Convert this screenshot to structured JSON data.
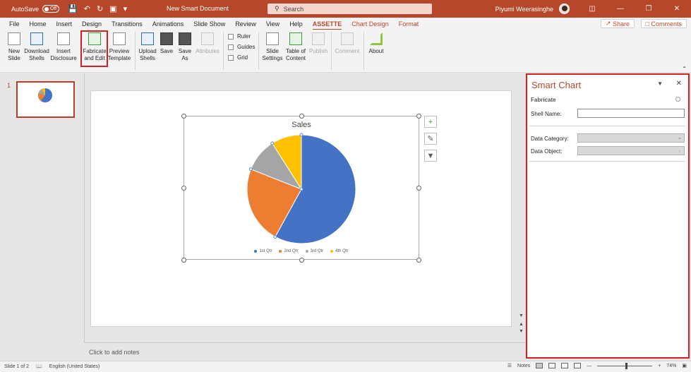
{
  "titlebar": {
    "autosave_label": "AutoSave",
    "autosave_state": "Off",
    "doc_title": "New Smart Document",
    "search_placeholder": "Search",
    "user_name": "Piyumi Weerasinghe",
    "accent_color": "#b7472a"
  },
  "menu": {
    "tabs": [
      "File",
      "Home",
      "Insert",
      "Design",
      "Transitions",
      "Animations",
      "Slide Show",
      "Review",
      "View",
      "Help",
      "ASSETTE",
      "Chart Design",
      "Format"
    ],
    "active_tab": "ASSETTE",
    "share_label": "Share",
    "comments_label": "Comments"
  },
  "ribbon": {
    "new_slide": "New Slide",
    "download_shells": "Download Shells",
    "insert_disclosure": "Insert Disclosure",
    "fabricate_edit": "Fabricate and Edit",
    "preview_template": "Preview Template",
    "upload_shells": "Upload Shells",
    "save": "Save",
    "save_as": "Save As",
    "attributes": "Attributes",
    "ruler": "Ruler",
    "guides": "Guides",
    "grid": "Grid",
    "slide_settings": "Slide Settings",
    "table_of_content": "Table of Content",
    "publish": "Publish",
    "comment": "Comment",
    "about": "About"
  },
  "thumbnails": {
    "slide_number": "1"
  },
  "chart_data": {
    "type": "pie",
    "title": "Sales",
    "categories": [
      "1st Qtr",
      "2nd Qtr",
      "3rd Qtr",
      "4th Qtr"
    ],
    "values": [
      58,
      23,
      10,
      9
    ],
    "colors": [
      "#4472c4",
      "#ed7d31",
      "#a5a5a5",
      "#ffc000"
    ],
    "legend_position": "bottom"
  },
  "notes": {
    "placeholder": "Click to add notes"
  },
  "taskpane": {
    "title": "Smart Chart",
    "section": "Fabricate",
    "shell_name_label": "Shell Name:",
    "shell_name_value": "",
    "data_category_label": "Data Category:",
    "data_object_label": "Data Object:"
  },
  "statusbar": {
    "slide_info": "Slide 1 of 2",
    "language": "English (United States)",
    "notes_label": "Notes",
    "zoom": "74%"
  }
}
